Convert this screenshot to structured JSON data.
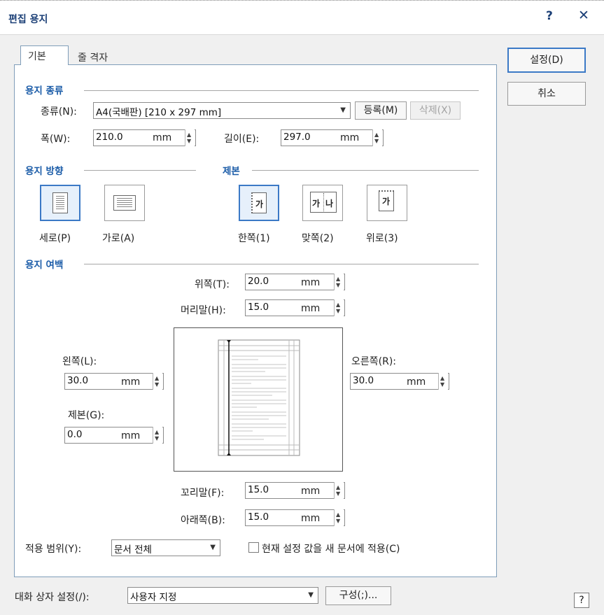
{
  "window": {
    "title": "편집 용지",
    "help": "?",
    "close": "✕"
  },
  "tabs": [
    "기본",
    "줄 격자"
  ],
  "buttons": {
    "ok": "설정(D)",
    "cancel": "취소"
  },
  "paper_type": {
    "section": "용지 종류",
    "type_label": "종류(N):",
    "type_value": "A4(국배판) [210 x 297 mm]",
    "register": "등록(M)",
    "delete": "삭제(X)",
    "width_label": "폭(W):",
    "width_value": "210.0",
    "length_label": "길이(E):",
    "length_value": "297.0",
    "unit": "mm"
  },
  "orientation": {
    "section": "용지 방향",
    "portrait": "세로(P)",
    "landscape": "가로(A)",
    "selected": "portrait"
  },
  "binding": {
    "section": "제본",
    "single": "한쪽(1)",
    "double": "맞쪽(2)",
    "top": "위로(3)",
    "icon_single": "가",
    "icon_double_left": "가",
    "icon_double_right": "나",
    "icon_top": "가",
    "selected": "single"
  },
  "margins": {
    "section": "용지 여백",
    "top_label": "위쪽(T):",
    "top_value": "20.0",
    "header_label": "머리말(H):",
    "header_value": "15.0",
    "left_label": "왼쪽(L):",
    "left_value": "30.0",
    "right_label": "오른쪽(R):",
    "right_value": "30.0",
    "gutter_label": "제본(G):",
    "gutter_value": "0.0",
    "footer_label": "꼬리말(F):",
    "footer_value": "15.0",
    "bottom_label": "아래쪽(B):",
    "bottom_value": "15.0",
    "unit": "mm"
  },
  "apply": {
    "scope_label": "적용 범위(Y):",
    "scope_value": "문서 전체",
    "new_doc_label": "현재 설정 값을 새 문서에 적용(C)",
    "new_doc_checked": false
  },
  "footer": {
    "dialog_setting_label": "대화 상자 설정(/):",
    "dialog_setting_value": "사용자 지정",
    "configure": "구성(;)...",
    "help": "?"
  },
  "colors": {
    "accent": "#3b79c6",
    "title": "#1b3f76",
    "section": "#1b5ca8"
  }
}
